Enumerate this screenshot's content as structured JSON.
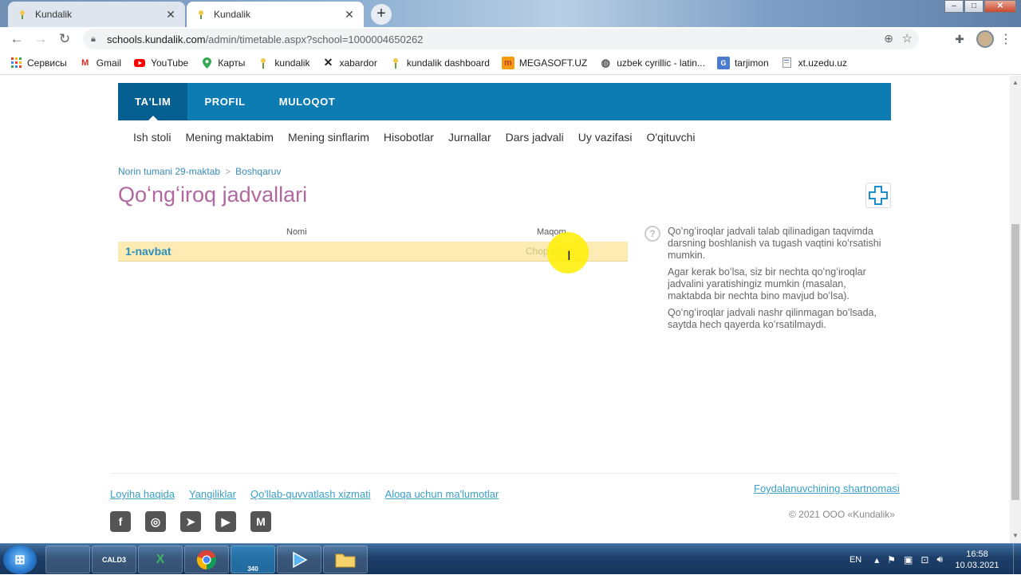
{
  "browser": {
    "tabs": [
      {
        "title": "Kundalik",
        "close": "✕"
      },
      {
        "title": "Kundalik",
        "close": "✕"
      }
    ],
    "new_tab": "+",
    "window_controls": {
      "min": "–",
      "max": "□",
      "close": "✕"
    },
    "url_host": "schools.kundalik.com",
    "url_path": "/admin/timetable.aspx?school=1000004650262"
  },
  "bookmarks": [
    {
      "label": "Сервисы",
      "icon": "apps-grid-icon"
    },
    {
      "label": "Gmail",
      "icon": "gmail-icon"
    },
    {
      "label": "YouTube",
      "icon": "youtube-icon"
    },
    {
      "label": "Карты",
      "icon": "maps-icon"
    },
    {
      "label": "kundalik",
      "icon": "kundalik-icon"
    },
    {
      "label": "xabardor",
      "icon": "x-icon"
    },
    {
      "label": "kundalik dashboard",
      "icon": "kundalik-icon"
    },
    {
      "label": "MEGASOFT.UZ",
      "icon": "megasoft-icon"
    },
    {
      "label": "uzbek cyrillic - latin...",
      "icon": "globe-icon"
    },
    {
      "label": "tarjimon",
      "icon": "translate-icon"
    },
    {
      "label": "xt.uzedu.uz",
      "icon": "page-icon"
    }
  ],
  "topnav": [
    "TA'LIM",
    "PROFIL",
    "MULOQOT"
  ],
  "subnav": [
    "Ish stoli",
    "Mening maktabim",
    "Mening sinflarim",
    "Hisobotlar",
    "Jurnallar",
    "Dars jadvali",
    "Uy vazifasi",
    "O'qituvchi"
  ],
  "breadcrumb": {
    "school": "Norin tumani 29-maktab",
    "sep": ">",
    "section": "Boshqaruv"
  },
  "page_title": "Qoʻngʻiroq jadvallari",
  "table": {
    "col_name": "Nomi",
    "col_status": "Maqom",
    "rows": [
      {
        "name": "1-navbat",
        "status": "Chop qilish"
      }
    ]
  },
  "help": [
    "Qoʻngʻiroqlar jadvali talab qilinadigan taqvimda darsning boshlanish va tugash vaqtini koʻrsatishi mumkin.",
    "Agar kerak boʻlsa, siz bir nechta qoʻngʻiroqlar jadvalini yaratishingiz mumkin (masalan, maktabda bir nechta bino mavjud boʻlsa).",
    "Qoʻngʻiroqlar jadvali nashr qilinmagan boʻlsada, saytda hech qayerda koʻrsatilmaydi."
  ],
  "footer": {
    "links": [
      "Loyiha haqida",
      "Yangiliklar",
      "Qo'llab-quvvatlash xizmati",
      "Aloqa uchun ma'lumotlar"
    ],
    "terms": "Foydalanuvchining shartnomasi",
    "copyright": "© 2021 ООО «Kundalik»",
    "social": [
      "f",
      "◎",
      "➤",
      "▶",
      "M"
    ]
  },
  "taskbar": {
    "apps": [
      "",
      "CALD3",
      "X",
      "",
      "340",
      "",
      ""
    ],
    "lang": "EN",
    "time": "16:58",
    "date": "10.03.2021"
  },
  "colors": {
    "accent": "#0d7cb3",
    "title": "#b0689f",
    "row_highlight": "#fcebb2",
    "link": "#3aa0c8"
  }
}
